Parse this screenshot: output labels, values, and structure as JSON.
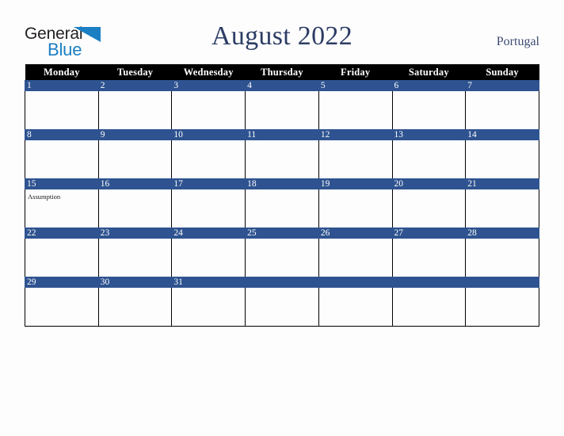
{
  "logo": {
    "word_one": "General",
    "word_two": "Blue",
    "triangle_icon": "blue-triangle-icon",
    "accent_color": "#1b7fc4"
  },
  "header": {
    "title": "August 2022",
    "country": "Portugal",
    "title_color": "#2c3c64"
  },
  "calendar": {
    "month": "August",
    "year": "2022",
    "weekday_headers": [
      "Monday",
      "Tuesday",
      "Wednesday",
      "Thursday",
      "Friday",
      "Saturday",
      "Sunday"
    ],
    "header_bg": "#000000",
    "daynum_band_color": "#2e5390",
    "grid_line_color": "#000000",
    "cell_bg": "#fdfdfd",
    "weeks": [
      [
        {
          "day": "1",
          "events": []
        },
        {
          "day": "2",
          "events": []
        },
        {
          "day": "3",
          "events": []
        },
        {
          "day": "4",
          "events": []
        },
        {
          "day": "5",
          "events": []
        },
        {
          "day": "6",
          "events": []
        },
        {
          "day": "7",
          "events": []
        }
      ],
      [
        {
          "day": "8",
          "events": []
        },
        {
          "day": "9",
          "events": []
        },
        {
          "day": "10",
          "events": []
        },
        {
          "day": "11",
          "events": []
        },
        {
          "day": "12",
          "events": []
        },
        {
          "day": "13",
          "events": []
        },
        {
          "day": "14",
          "events": []
        }
      ],
      [
        {
          "day": "15",
          "events": [
            "Assumption"
          ]
        },
        {
          "day": "16",
          "events": []
        },
        {
          "day": "17",
          "events": []
        },
        {
          "day": "18",
          "events": []
        },
        {
          "day": "19",
          "events": []
        },
        {
          "day": "20",
          "events": []
        },
        {
          "day": "21",
          "events": []
        }
      ],
      [
        {
          "day": "22",
          "events": []
        },
        {
          "day": "23",
          "events": []
        },
        {
          "day": "24",
          "events": []
        },
        {
          "day": "25",
          "events": []
        },
        {
          "day": "26",
          "events": []
        },
        {
          "day": "27",
          "events": []
        },
        {
          "day": "28",
          "events": []
        }
      ],
      [
        {
          "day": "29",
          "events": []
        },
        {
          "day": "30",
          "events": []
        },
        {
          "day": "31",
          "events": []
        },
        {
          "day": "",
          "events": []
        },
        {
          "day": "",
          "events": []
        },
        {
          "day": "",
          "events": []
        },
        {
          "day": "",
          "events": []
        }
      ]
    ]
  }
}
